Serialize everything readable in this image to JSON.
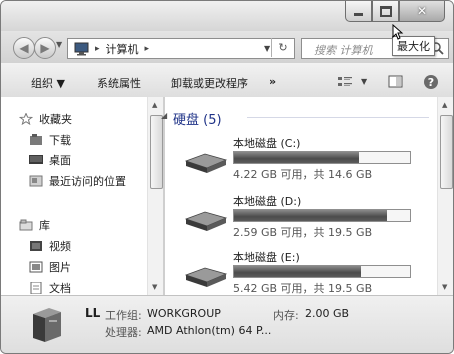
{
  "window": {
    "maximize_tooltip": "最大化"
  },
  "addressbar": {
    "crumbs": [
      "▸",
      "计算机",
      "▸"
    ],
    "search_placeholder": "搜索 计算机"
  },
  "toolbar": {
    "organize": "组织 ▼",
    "system_properties": "系统属性",
    "uninstall": "卸载或更改程序",
    "more": "»"
  },
  "nav": {
    "favorites": "收藏夹",
    "downloads": "下载",
    "desktop": "桌面",
    "recent": "最近访问的位置",
    "libraries": "库",
    "videos": "视频",
    "pictures": "图片",
    "documents": "文档"
  },
  "content": {
    "group_label": "硬盘 (5)",
    "drives": [
      {
        "name": "本地磁盘 (C:)",
        "free_text": "4.22 GB 可用，共 14.6 GB",
        "used_fraction": 0.71
      },
      {
        "name": "本地磁盘 (D:)",
        "free_text": "2.59 GB 可用，共 19.5 GB",
        "used_fraction": 0.87
      },
      {
        "name": "本地磁盘 (E:)",
        "free_text": "5.42 GB 可用，共 19.5 GB",
        "used_fraction": 0.72
      }
    ]
  },
  "details": {
    "computer_name": "LL",
    "workgroup_label": "工作组:",
    "workgroup_value": "WORKGROUP",
    "memory_label": "内存:",
    "memory_value": "2.00 GB",
    "processor_label": "处理器:",
    "processor_value": "AMD Athlon(tm) 64 P..."
  },
  "colors": {
    "group_header": "#1e3287",
    "toolbar_bg": "#e8e8e8",
    "drive_bar_fill": "#5c5c5c"
  },
  "icons": [
    "back-arrow-icon",
    "forward-arrow-icon",
    "computer-icon",
    "refresh-icon",
    "search-icon",
    "star-icon",
    "download-folder-icon",
    "desktop-icon",
    "recent-places-icon",
    "library-icon",
    "video-icon",
    "picture-icon",
    "document-icon",
    "hard-drive-icon",
    "help-icon",
    "view-icon",
    "preview-pane-icon"
  ]
}
